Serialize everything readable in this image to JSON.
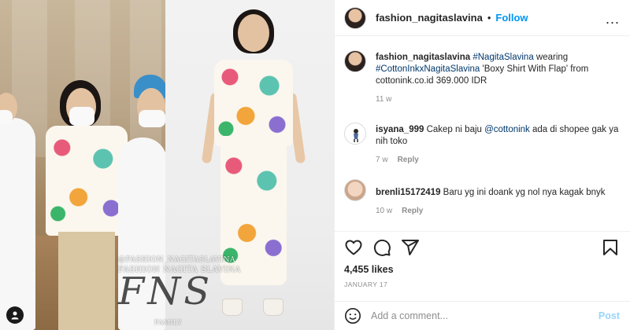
{
  "header": {
    "username": "fashion_nagitaslavina",
    "separator": "•",
    "follow_label": "Follow",
    "more_label": "..."
  },
  "caption": {
    "username": "fashion_nagitaslavina",
    "tag1": "#NagitaSlavina",
    "text1": " wearing ",
    "tag2": "#CottonInkxNagitaSlavina",
    "text2": " 'Boxy Shirt With Flap' from cottonink.co.id 369.000 IDR",
    "time": "11 w"
  },
  "comments": [
    {
      "username": "isyana_999",
      "pre": " Cakep ni baju ",
      "mention": "@cottonink",
      "post": " ada di shopee gak ya nih toko",
      "time": "7 w",
      "reply_label": "Reply"
    },
    {
      "username": "brenli15172419",
      "text": " Baru yg ini doank yg nol nya kagak bnyk",
      "time": "10 w",
      "reply_label": "Reply"
    }
  ],
  "actions": {
    "like": "heart-icon",
    "comment": "comment-icon",
    "share": "share-icon",
    "save": "bookmark-icon"
  },
  "likes": "4,455 likes",
  "date": "JANUARY 17",
  "add_comment": {
    "placeholder": "Add a comment...",
    "post_label": "Post"
  },
  "media": {
    "watermark_line1": "@FASHION_NAGITASLAVINA",
    "watermark_line2": "FASHION NAGITA SLAVINA",
    "logo": "FNS",
    "watermark_line3": "FAMILY",
    "user_tag": "user-tag-icon"
  }
}
